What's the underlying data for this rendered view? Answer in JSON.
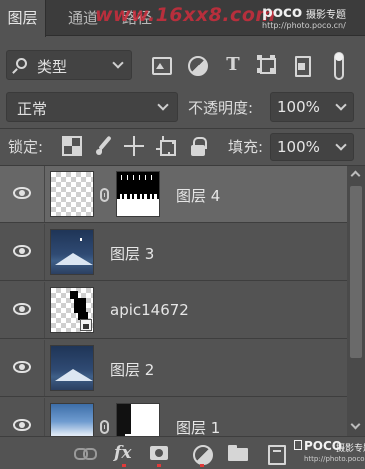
{
  "tabs": [
    {
      "label": "图层",
      "active": true
    },
    {
      "label": "通道",
      "active": false
    },
    {
      "label": "路径",
      "active": false
    }
  ],
  "watermarks": {
    "site": "www.16xx8.com",
    "poco": "poco",
    "poco_cn": "摄影专题",
    "poco_url": "http://photo.poco.cn/"
  },
  "filter": {
    "kind_label": "类型",
    "icons": [
      "image-filter-icon",
      "adjustment-filter-icon",
      "type-filter-icon",
      "shape-filter-icon",
      "smart-object-filter-icon"
    ]
  },
  "blend": {
    "mode": "正常",
    "opacity_label": "不透明度:",
    "opacity_value": "100%"
  },
  "lock": {
    "label": "锁定:",
    "fill_label": "填充:",
    "fill_value": "100%"
  },
  "layers": [
    {
      "name": "图层 4",
      "selected": true,
      "visible": true,
      "thumb": "transparent",
      "mask": "mask-dark-top",
      "linked": true
    },
    {
      "name": "图层 3",
      "selected": false,
      "visible": true,
      "thumb": "night-mountain"
    },
    {
      "name": "apic14672",
      "selected": false,
      "visible": true,
      "thumb": "transparent-black-shapes",
      "smart_object": true
    },
    {
      "name": "图层 2",
      "selected": false,
      "visible": true,
      "thumb": "night-mountain"
    },
    {
      "name": "图层 1",
      "selected": false,
      "visible": true,
      "thumb": "snow-sky",
      "mask": "mask-white-dark-left",
      "linked": true
    }
  ],
  "bottom_toolbar": {
    "fx_label": "fx",
    "icons": [
      "link-layers-icon",
      "fx-icon",
      "add-mask-icon",
      "adjustment-layer-icon",
      "new-group-icon",
      "new-layer-icon"
    ],
    "watermark_poco": "POCO",
    "watermark_cn": "摄影专题",
    "watermark_url": "http://photo.poco.cn/"
  },
  "colors": {
    "panel_bg": "#535353",
    "selected_layer": "#676767",
    "tab_bar": "#3c3c3c",
    "text": "#e6e6e6",
    "watermark_red": "#cd2d3c"
  }
}
